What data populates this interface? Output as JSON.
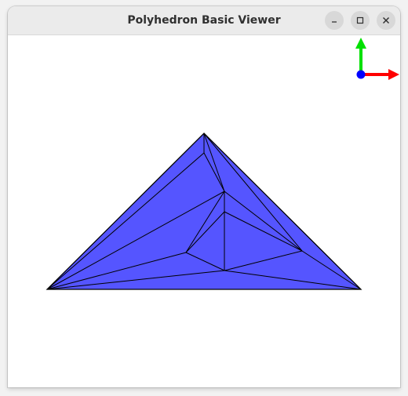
{
  "window": {
    "title": "Polyhedron Basic Viewer"
  },
  "controls": {
    "minimize_icon": "minimize-icon",
    "maximize_icon": "maximize-icon",
    "close_icon": "close-icon"
  },
  "axes_gizmo": {
    "x_color": "#ff0000",
    "y_color": "#00e000",
    "z_color": "#0000ff"
  },
  "polyhedron": {
    "fill_color": "#5555ff",
    "edge_color": "#000000"
  }
}
